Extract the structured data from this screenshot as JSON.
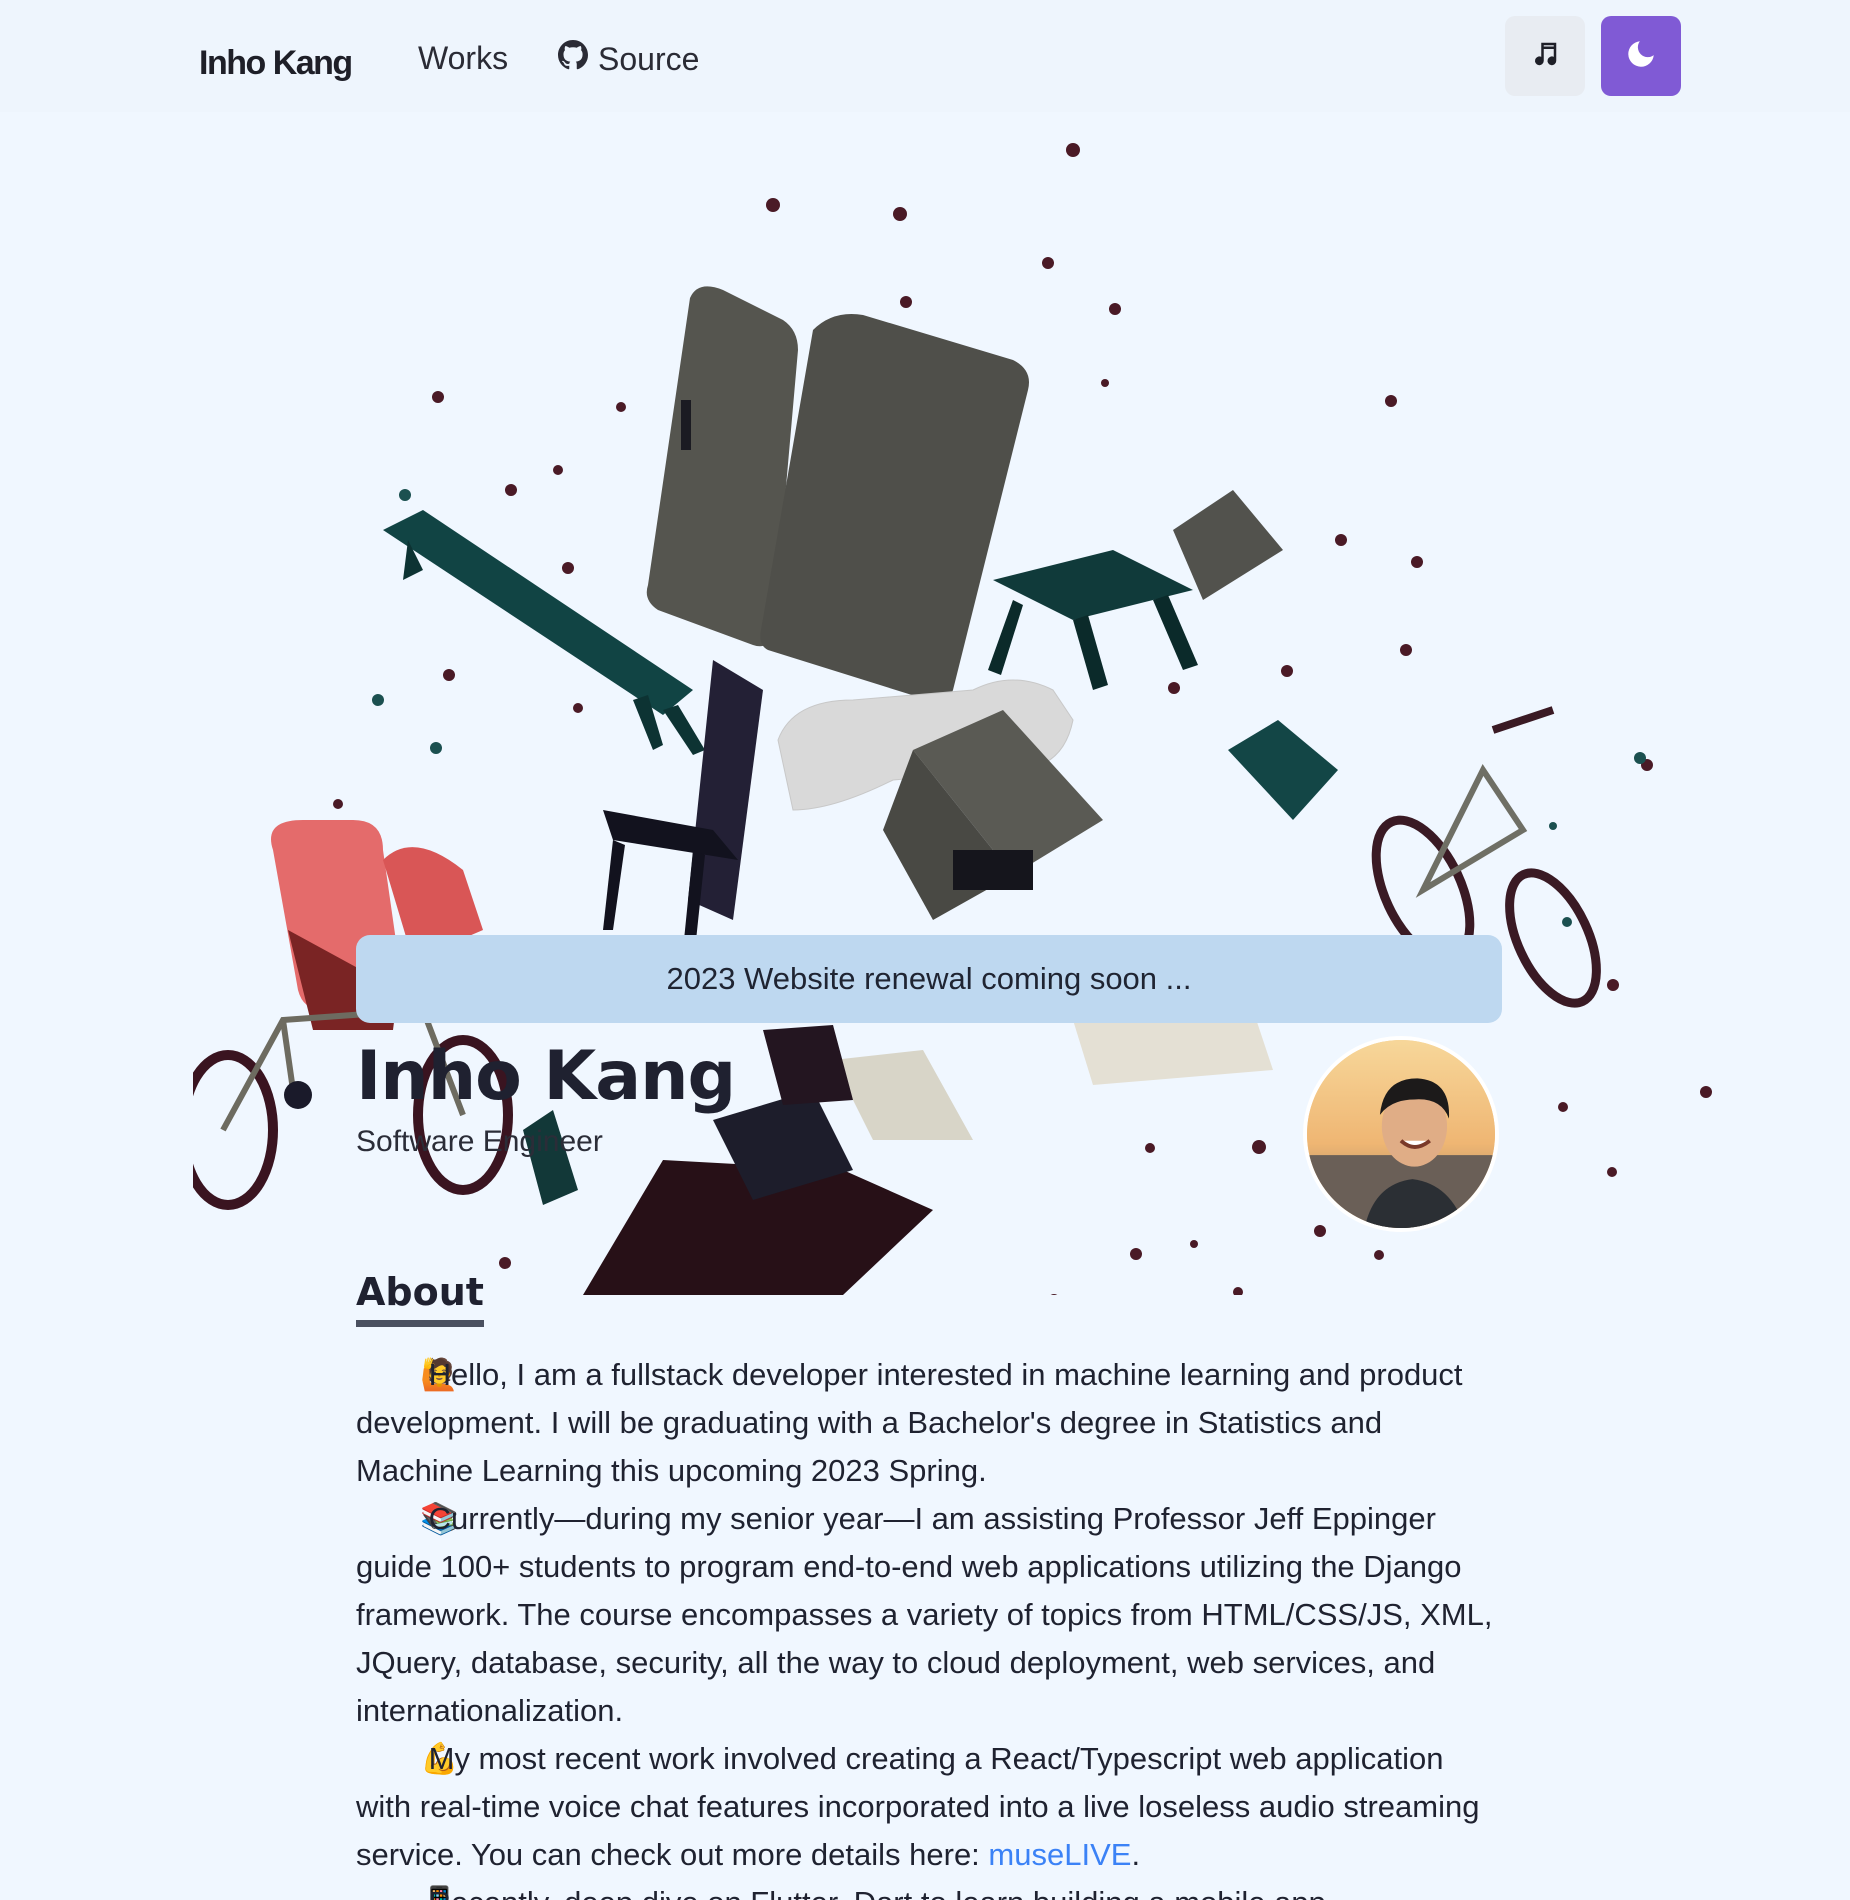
{
  "header": {
    "logo": "Inho Kang",
    "nav": {
      "works": "Works",
      "source": "Source"
    },
    "icons": {
      "source": "github-icon",
      "music": "music-note-icon",
      "theme": "moon-icon"
    },
    "theme_button_color": "#805ad5"
  },
  "banner": {
    "text": "2023 Website renewal coming soon ..."
  },
  "profile": {
    "name": "Inho Kang",
    "title": "Software Engineer"
  },
  "about": {
    "heading": "About",
    "paragraphs": [
      {
        "emoji": "🙋",
        "text": "Hello, I am a fullstack developer interested in machine learning and product development. I will be graduating with a Bachelor's degree in Statistics and Machine Learning this upcoming 2023 Spring."
      },
      {
        "emoji": "📚",
        "text": "Currently—during my senior year—I am assisting Professor Jeff Eppinger guide 100+ students to program end-to-end web applications utilizing the Django framework. The course encompasses a variety of topics from HTML/CSS/JS, XML, JQuery, database, security, all the way to cloud deployment, web services, and internationalization."
      },
      {
        "emoji": "💪",
        "text": "My most recent work involved creating a React/Typescript web application with real-time voice chat features incorporated into a live loseless audio streaming service. You can check out more details here: ",
        "link": "museLIVE",
        "after": "."
      },
      {
        "emoji": "📱",
        "text": "Recently, deep dive on Flutter, Dart to learn building a mobile app"
      }
    ]
  },
  "colors": {
    "background": "#f0f7ff",
    "banner": "#bed8f0",
    "link": "#3b82f6"
  }
}
